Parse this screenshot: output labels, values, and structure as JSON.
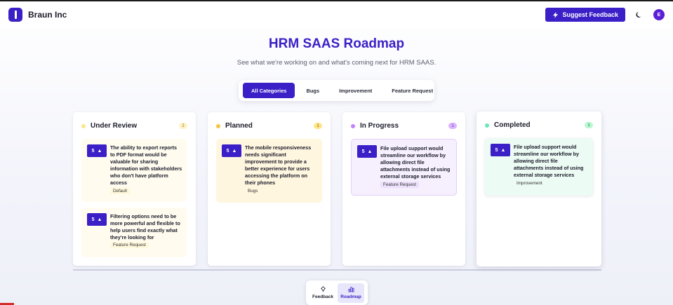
{
  "header": {
    "brand": "Braun Inc",
    "suggest_label": "Suggest Feedback",
    "avatar_initial": "E"
  },
  "hero": {
    "title": "HRM SAAS Roadmap",
    "subtitle": "See what we're working on and what's coming next for HRM SAAS."
  },
  "filters": [
    "All Categories",
    "Bugs",
    "Improvement",
    "Feature Request"
  ],
  "columns": [
    {
      "title": "Under Review",
      "count": "2",
      "dot_color": "#fde68a",
      "count_bg": "#fef3c7",
      "count_color": "#a16207",
      "cards": [
        {
          "votes": "5",
          "text": "The ability to export reports to PDF format would be valuable for sharing information with stakeholders who don't have platform access",
          "tag": "Default"
        },
        {
          "votes": "5",
          "text": "Filtering options need to be more powerful and flexible to help users find exactly what they're looking for",
          "tag": "Feature Request"
        }
      ]
    },
    {
      "title": "Planned",
      "count": "1",
      "dot_color": "#f6c343",
      "count_bg": "#fde68a",
      "count_color": "#92400e",
      "cards": [
        {
          "votes": "5",
          "text": "The mobile responsiveness needs significant improvement to provide a better experience for users accessing the platform on their phones",
          "tag": "Bugs"
        }
      ]
    },
    {
      "title": "In Progress",
      "count": "1",
      "dot_color": "#c084fc",
      "count_bg": "#d8b4fe",
      "count_color": "#6b21a8",
      "cards": [
        {
          "votes": "5",
          "text": "File upload support would streamline our workflow by allowing direct file attachments instead of using external storage services",
          "tag": "Feature Request"
        }
      ]
    },
    {
      "title": "Completed",
      "count": "1",
      "dot_color": "#6ee7b7",
      "count_bg": "#bbf7d0",
      "count_color": "#047857",
      "cards": [
        {
          "votes": "5",
          "text": "File upload support would streamline our workflow by allowing direct file attachments instead of using external storage services",
          "tag": "Improvement"
        }
      ]
    }
  ],
  "bottom_nav": {
    "feedback_label": "Feedback",
    "roadmap_label": "Roadmap"
  },
  "icons": {
    "brand": "logo-icon",
    "suggest": "lightning-icon",
    "theme": "moon-icon",
    "vote": "arrow-up-icon",
    "feedback": "lightbulb-icon",
    "roadmap": "bar-chart-icon"
  },
  "colors": {
    "accent": "#3b1fc7"
  }
}
